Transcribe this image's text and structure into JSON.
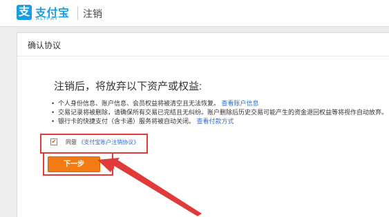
{
  "header": {
    "logo_glyph": "支",
    "logo_cn": "支付宝",
    "logo_en": "ALIPAY",
    "page_label": "注销"
  },
  "card": {
    "title": "确认协议",
    "headline": "注销后，将放弃以下资产或权益:",
    "rules": [
      {
        "text": "个人身份信息、账户信息、会员权益将被清空且无法恢复。",
        "link": "查看账户信息"
      },
      {
        "text": "交易记录将被删除，请确保所有交易已完结且无纠纷。账户删除后历史交易可能产生的资金退回权益等将视作自动放弃。",
        "link": ""
      },
      {
        "text": "银行卡的快捷支付（含卡通）服务将被自动关闭。",
        "link": "查看付款方式"
      }
    ],
    "bullet": "•",
    "agree": {
      "checked": true,
      "check_glyph": "✔",
      "label": "同意",
      "link": "《支付宝账户注销协议》"
    },
    "next_button": "下一步"
  },
  "colors": {
    "brand_blue": "#1a9de1",
    "button_orange": "#f37b14",
    "highlight_red": "#e03a3a",
    "link_blue": "#2a6fd6"
  }
}
